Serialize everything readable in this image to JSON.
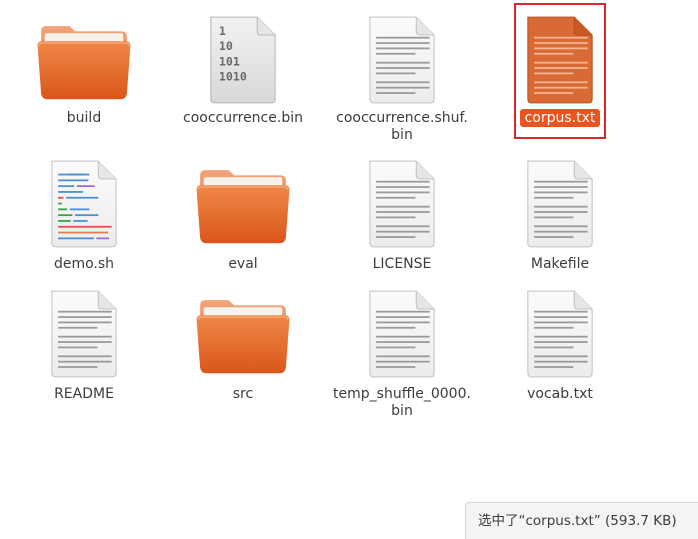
{
  "files": [
    {
      "name": "build",
      "type": "folder",
      "selected": false
    },
    {
      "name": "cooccurrence.bin",
      "type": "binary",
      "selected": false
    },
    {
      "name": "cooccurrence.shuf.\nbin",
      "type": "text",
      "selected": false
    },
    {
      "name": "corpus.txt",
      "type": "text",
      "selected": true
    },
    {
      "name": "demo.sh",
      "type": "script",
      "selected": false
    },
    {
      "name": "eval",
      "type": "folder",
      "selected": false
    },
    {
      "name": "LICENSE",
      "type": "text",
      "selected": false
    },
    {
      "name": "Makefile",
      "type": "text",
      "selected": false
    },
    {
      "name": "README",
      "type": "text",
      "selected": false
    },
    {
      "name": "src",
      "type": "folder",
      "selected": false
    },
    {
      "name": "temp_shuffle_0000.\nbin",
      "type": "text",
      "selected": false
    },
    {
      "name": "vocab.txt",
      "type": "text",
      "selected": false
    }
  ],
  "binary_icon_digits": [
    "1",
    "10",
    "101",
    "1010"
  ],
  "status": {
    "text": "选中了“corpus.txt” (593.7 KB)"
  },
  "colors": {
    "accent": "#e95420",
    "selection_outline": "#e0262b",
    "folder_orange": "#e3672b"
  }
}
